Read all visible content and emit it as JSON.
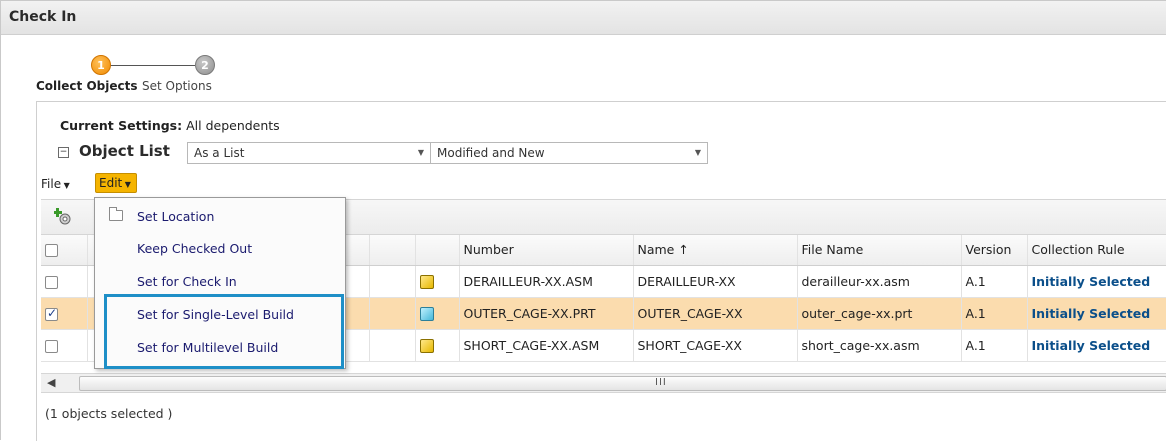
{
  "window": {
    "title": "Check In"
  },
  "wizard": {
    "steps": [
      {
        "number": "1",
        "label": "Collect Objects",
        "active": true
      },
      {
        "number": "2",
        "label": "Set Options",
        "active": false
      }
    ]
  },
  "settings": {
    "label": "Current Settings:",
    "value": "All dependents"
  },
  "object_list": {
    "title": "Object List",
    "view_select": "As a List",
    "filter_select": "Modified and New"
  },
  "menu": {
    "file_label": "File",
    "edit_label": "Edit"
  },
  "dropdown": {
    "items": [
      {
        "label": "Set Location",
        "icon": "folder-icon"
      },
      {
        "label": "Keep Checked Out"
      },
      {
        "label": "Set for Check In"
      },
      {
        "label": "Set for Single-Level Build"
      },
      {
        "label": "Set for Multilevel Build"
      }
    ]
  },
  "table": {
    "columns": [
      "Number",
      "Name ↑",
      "File Name",
      "Version",
      "Collection Rule"
    ],
    "rows": [
      {
        "number": "DERAILLEUR-XX.ASM",
        "name": "DERAILLEUR-XX",
        "file_name": "derailleur-xx.asm",
        "version": "A.1",
        "rule": "Initially Selected",
        "checked": false
      },
      {
        "number": "OUTER_CAGE-XX.PRT",
        "name": "OUTER_CAGE-XX",
        "file_name": "outer_cage-xx.prt",
        "version": "A.1",
        "rule": "Initially Selected",
        "checked": true
      },
      {
        "number": "SHORT_CAGE-XX.ASM",
        "name": "SHORT_CAGE-XX",
        "file_name": "short_cage-xx.asm",
        "version": "A.1",
        "rule": "Initially Selected",
        "checked": false
      }
    ]
  },
  "scrollbar": {
    "grip": "III"
  },
  "status": {
    "selected_text": "(1 objects selected )"
  },
  "colors": {
    "accent": "#f5b400",
    "selected_row": "#fbdcae",
    "highlight": "#1e8fc7",
    "rule_text": "#0b4f8a"
  }
}
